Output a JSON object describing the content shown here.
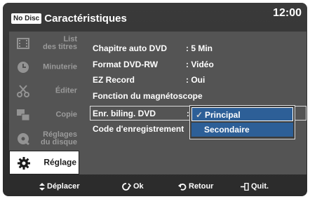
{
  "header": {
    "badge": "No Disc",
    "title": "Caractéristiques",
    "clock": "12:00"
  },
  "sidebar": {
    "items": [
      {
        "line1": "List",
        "line2": "des titres",
        "icon": "film-icon"
      },
      {
        "line1": "Minuterie",
        "line2": "",
        "icon": "clock-icon"
      },
      {
        "line1": "Éditer",
        "line2": "",
        "icon": "scissors-icon"
      },
      {
        "line1": "Copie",
        "line2": "",
        "icon": "copy-icon"
      },
      {
        "line1": "Réglages",
        "line2": "du disque",
        "icon": "disc-icon"
      },
      {
        "line1": "Réglage",
        "line2": "",
        "icon": "gear-icon",
        "active": true
      }
    ]
  },
  "settings": {
    "rows": [
      {
        "label": "Chapitre auto DVD",
        "value": ": 5 Min"
      },
      {
        "label": "Format DVD-RW",
        "value": ": Vidéo"
      },
      {
        "label": "EZ Record",
        "value": ": Oui"
      },
      {
        "label": "Fonction du magnétoscope",
        "value": ""
      },
      {
        "label": "Enr. biling. DVD",
        "value": ":"
      },
      {
        "label": "Code d'enregistrement",
        "value": ""
      }
    ]
  },
  "dropdown": {
    "options": [
      {
        "label": "Principal",
        "selected": true
      },
      {
        "label": "Secondaire",
        "selected": false
      }
    ]
  },
  "footer": {
    "move": "Déplacer",
    "ok": "Ok",
    "back": "Retour",
    "quit": "Quit."
  },
  "colors": {
    "frame": "#2f2f2f",
    "panel": "#545454",
    "highlight": "#2d5f97",
    "active_item": "#ffffff"
  }
}
